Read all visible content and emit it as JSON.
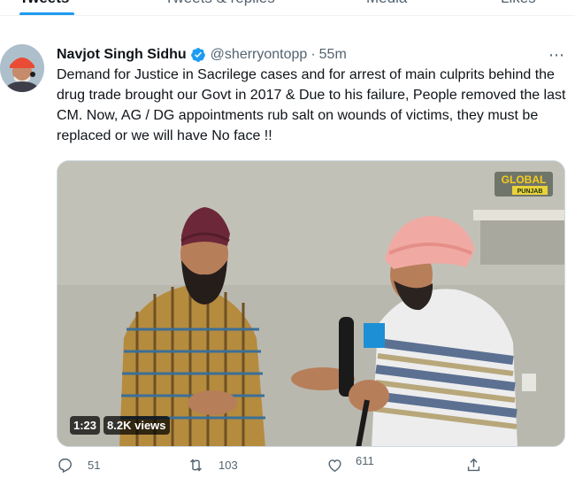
{
  "tabs": [
    {
      "label": "Tweets",
      "active": true
    },
    {
      "label": "Tweets & replies",
      "active": false
    },
    {
      "label": "Media",
      "active": false
    },
    {
      "label": "Likes",
      "active": false
    }
  ],
  "tweet": {
    "author": "Navjot Singh Sidhu",
    "verified": true,
    "handle": "@sherryontopp",
    "separator": "·",
    "time": "55m",
    "text": "Demand for Justice in Sacrilege cases and for arrest of main culprits behind the drug trade brought our Govt in 2017 & Due to his failure, People removed the last CM. Now, AG / DG appointments rub salt on wounds of victims, they must be replaced or we will have No face !!",
    "media": {
      "logo_line1": "GLOBAL",
      "logo_line2": "PUNJAB",
      "duration": "1:23",
      "views": "8.2K views"
    },
    "actions": {
      "replies": "51",
      "retweets": "103",
      "likes": "611"
    }
  },
  "colors": {
    "accent": "#1d9bf0",
    "text_primary": "#0f1419",
    "text_secondary": "#536471"
  }
}
